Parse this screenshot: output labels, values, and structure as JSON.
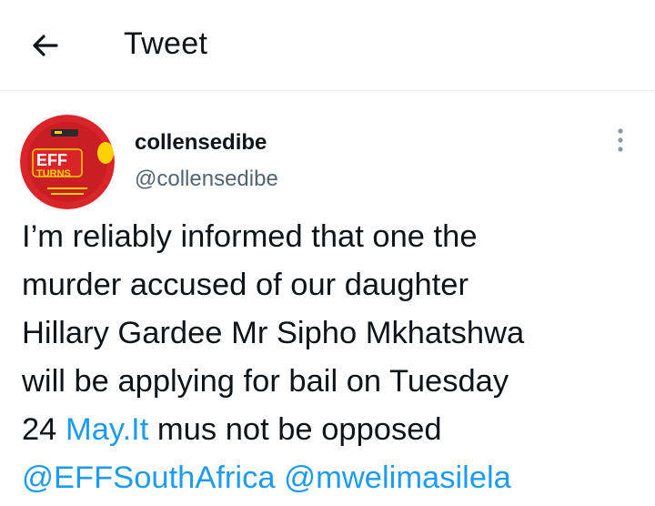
{
  "header": {
    "title": "Tweet",
    "back_icon": "arrow-left-icon"
  },
  "author": {
    "display_name": "collensedibe",
    "handle": "@collensedibe",
    "avatar": {
      "brand_line1": "EFF",
      "brand_line2": "TURNS",
      "colors": {
        "background": "#d9252a",
        "badge": "#ffd200"
      }
    },
    "more_icon": "vertical-ellipsis-icon"
  },
  "tweet": {
    "lines": [
      {
        "segments": [
          {
            "text": "I’m reliably informed that one the",
            "link": false
          }
        ]
      },
      {
        "segments": [
          {
            "text": "murder accused of our daughter",
            "link": false
          }
        ]
      },
      {
        "segments": [
          {
            "text": "Hillary Gardee Mr Sipho Mkhatshwa",
            "link": false
          }
        ]
      },
      {
        "segments": [
          {
            "text": "will be applying for bail on Tuesday",
            "link": false
          }
        ]
      },
      {
        "segments": [
          {
            "text": "24 ",
            "link": false
          },
          {
            "text": "May.It",
            "link": true
          },
          {
            "text": " mus not be opposed",
            "link": false
          }
        ]
      },
      {
        "segments": [
          {
            "text": "@EFFSouthAfrica",
            "link": true
          },
          {
            "text": " ",
            "link": false
          },
          {
            "text": "@mwelimasilela",
            "link": true
          }
        ]
      }
    ]
  },
  "colors": {
    "link": "#1d9bf0",
    "text": "#0f1419",
    "secondary": "#536471",
    "divider": "#e6ecf0"
  }
}
